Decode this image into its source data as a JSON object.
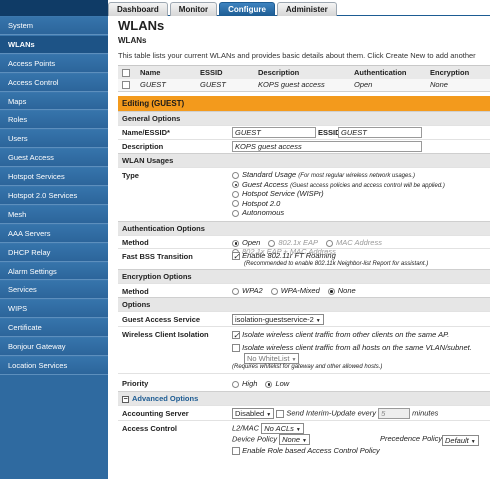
{
  "top_tabs": [
    "Dashboard",
    "Monitor",
    "Configure",
    "Administer"
  ],
  "active_tab": "Configure",
  "sidebar": {
    "items": [
      "System",
      "WLANs",
      "Access Points",
      "Access Control",
      "Maps",
      "Roles",
      "Users",
      "Guest Access",
      "Hotspot Services",
      "Hotspot 2.0 Services",
      "Mesh",
      "AAA Servers",
      "DHCP Relay",
      "Alarm Settings",
      "Services",
      "WIPS",
      "Certificate",
      "Bonjour Gateway",
      "Location Services"
    ],
    "active": "WLANs"
  },
  "page": {
    "title": "WLANs",
    "section": "WLANs",
    "description": "This table lists your current WLANs and provides basic details about them. Click Create New to add another"
  },
  "wlan_table": {
    "headers": [
      "Name",
      "ESSID",
      "Description",
      "Authentication",
      "Encryption"
    ],
    "rows": [
      {
        "name": "GUEST",
        "essid": "GUEST",
        "description": "KOPS guest access",
        "authentication": "Open",
        "encryption": "None"
      }
    ]
  },
  "editing": {
    "header": "Editing (GUEST)",
    "general": {
      "section": "General Options",
      "name_label": "Name/ESSID*",
      "name_value": "GUEST",
      "essid_label": "ESSID",
      "essid_value": "GUEST",
      "desc_label": "Description",
      "desc_value": "KOPS guest access"
    },
    "usages": {
      "section": "WLAN Usages",
      "type_label": "Type",
      "options": [
        {
          "label": "Standard Usage",
          "note": "(For most regular wireless network usages.)",
          "selected": false
        },
        {
          "label": "Guest Access",
          "note": "(Guest access policies and access control will be applied.)",
          "selected": true
        },
        {
          "label": "Hotspot Service (WISPr)",
          "note": "",
          "selected": false
        },
        {
          "label": "Hotspot 2.0",
          "note": "",
          "selected": false
        },
        {
          "label": "Autonomous",
          "note": "",
          "selected": false
        }
      ]
    },
    "auth": {
      "section": "Authentication Options",
      "method_label": "Method",
      "methods": [
        {
          "label": "Open",
          "selected": true,
          "enabled": true
        },
        {
          "label": "802.1x EAP",
          "selected": false,
          "enabled": false
        },
        {
          "label": "MAC Address",
          "selected": false,
          "enabled": false
        },
        {
          "label": "802.1x EAP + MAC Address",
          "selected": false,
          "enabled": false
        }
      ],
      "fbt_label": "Fast BSS Transition",
      "fbt_text": "Enable 802.11r FT Roaming",
      "fbt_note": "(Recommended to enable 802.11k Neighbor-list Report for assistant.)"
    },
    "encryption": {
      "section": "Encryption Options",
      "method_label": "Method",
      "methods": [
        {
          "label": "WPA2",
          "selected": false
        },
        {
          "label": "WPA-Mixed",
          "selected": false
        },
        {
          "label": "None",
          "selected": true
        }
      ]
    },
    "options": {
      "section": "Options",
      "guest_service_label": "Guest Access Service",
      "guest_service_value": "isolation-guestservice-2",
      "isolation_label": "Wireless Client Isolation",
      "isolation_1": "Isolate wireless client traffic from other clients on the same AP.",
      "isolation_2": "Isolate wireless client traffic from all hosts on the same VLAN/subnet.",
      "whitelist_value": "No WhiteList",
      "whitelist_note": "(Requires whitelist for gateway and other allowed hosts.)",
      "priority_label": "Priority",
      "priority": [
        {
          "label": "High",
          "selected": false
        },
        {
          "label": "Low",
          "selected": true
        }
      ]
    },
    "advanced": {
      "section": "Advanced Options",
      "accounting_label": "Accounting Server",
      "accounting_value": "Disabled",
      "interim_text": "Send Interim-Update every",
      "interim_value": "5",
      "interim_unit": "minutes",
      "access_control_label": "Access Control",
      "l2mac_label": "L2/MAC",
      "l2mac_value": "No ACLs",
      "device_policy_label": "Device Policy",
      "device_policy_value": "None",
      "precedence_label": "Precedence Policy",
      "precedence_value": "Default",
      "role_text": "Enable Role based Access Control Policy"
    }
  }
}
